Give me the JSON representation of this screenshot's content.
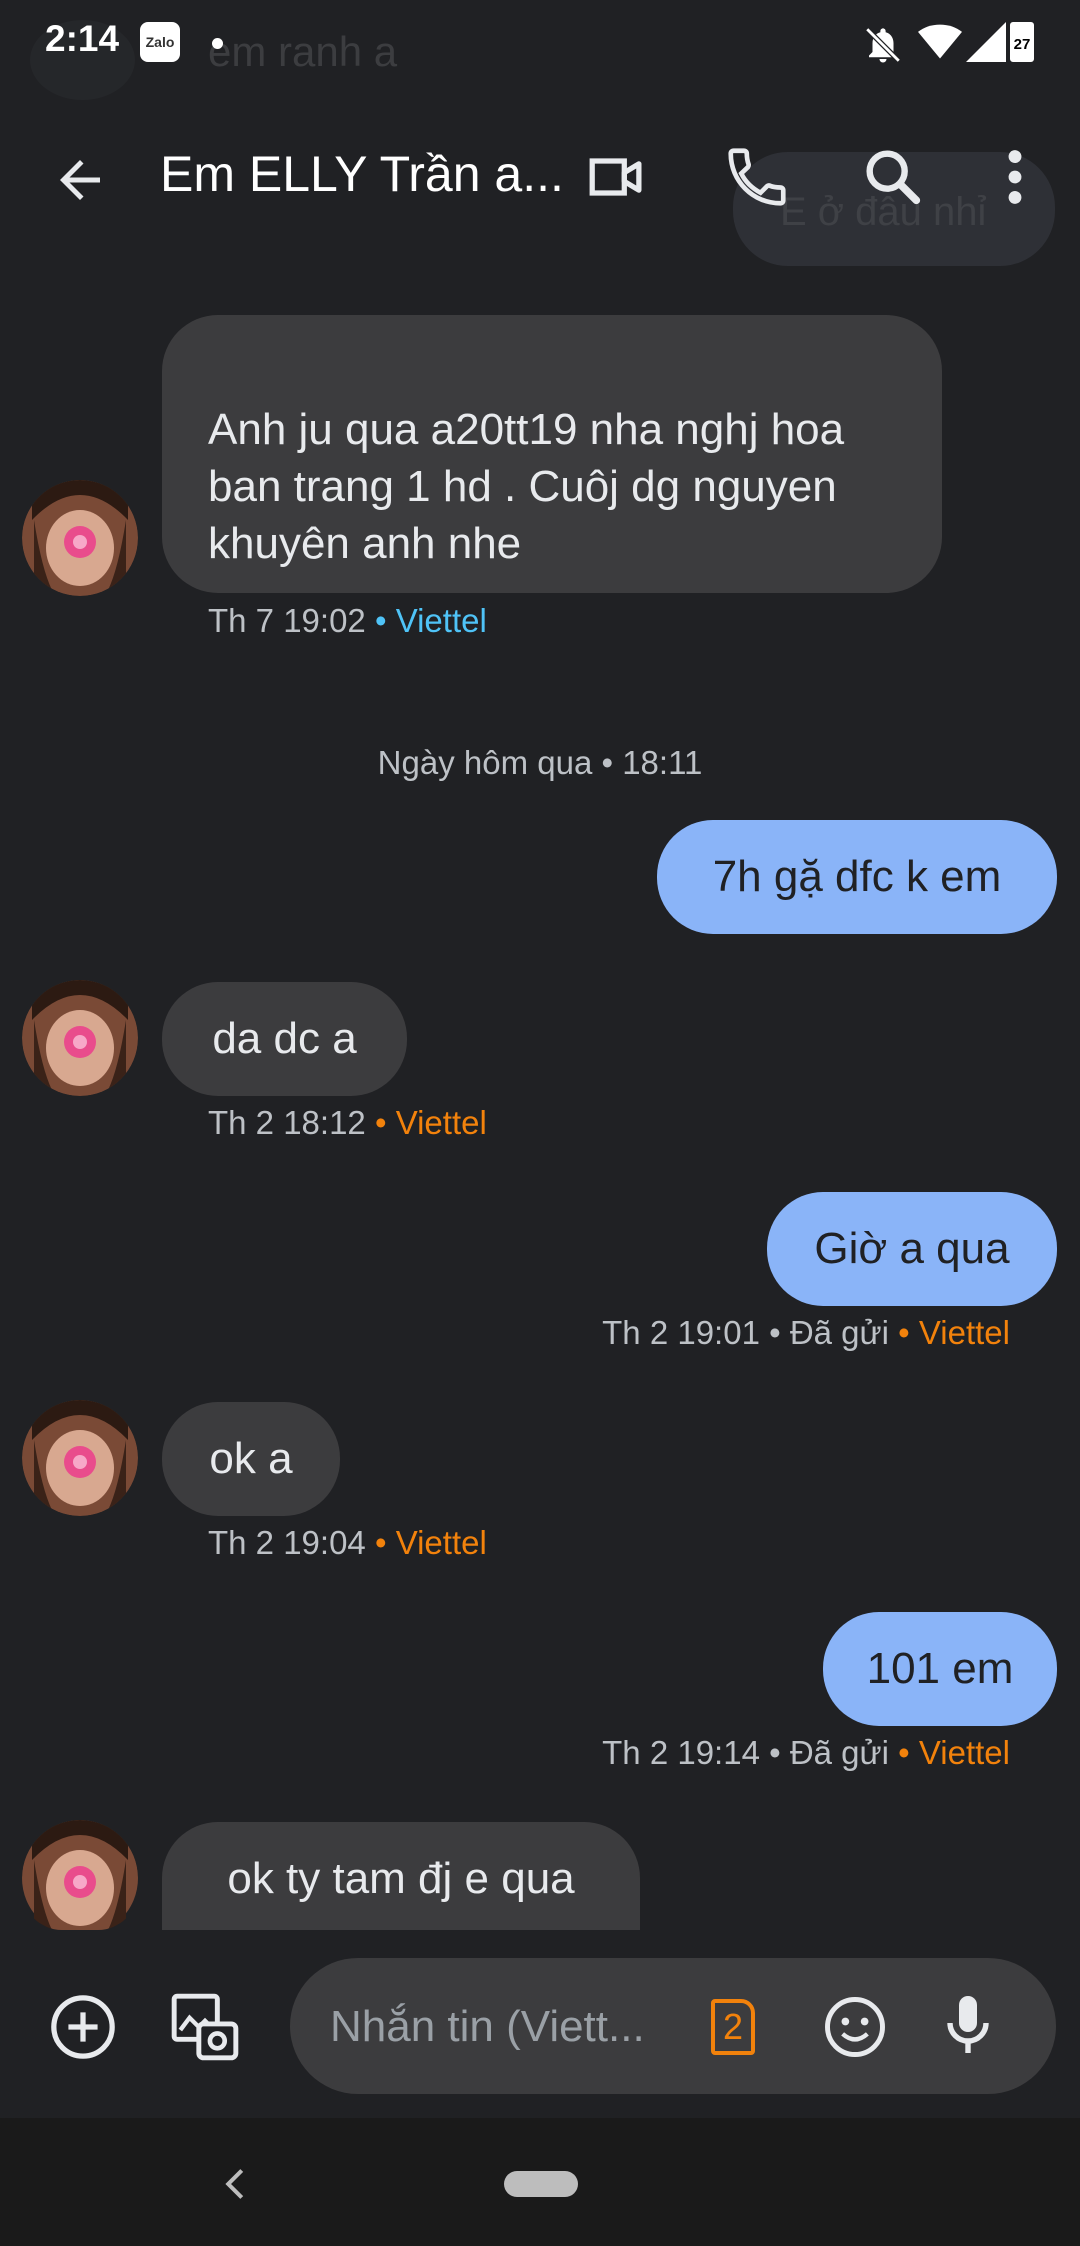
{
  "status_bar": {
    "time": "2:14",
    "zalo": "Zalo",
    "battery": "27"
  },
  "ghost": {
    "text1": "em ranh a",
    "text2": "E ở đâu nhỉ"
  },
  "header": {
    "title": "Em ELLY Trần a..."
  },
  "messages": [
    {
      "dir": "in",
      "text": "Anh ju qua a20tt19 nha nghj hoa ban trang 1  hd . Cuôj dg nguyen khuyên anh nhe",
      "time": "Th 7 19:02",
      "carrier": "Viettel",
      "carrier_color": "#4fc3f7"
    },
    {
      "dir": "out",
      "text": "7h gặ dfc k em"
    },
    {
      "dir": "in",
      "text": "da dc a",
      "time": "Th 2 18:12",
      "carrier": "Viettel",
      "carrier_color": "#f2820c"
    },
    {
      "dir": "out",
      "text": "Giờ a qua",
      "time": "Th 2 19:01",
      "status": "Đã gửi",
      "carrier": "Viettel"
    },
    {
      "dir": "in",
      "text": "ok a",
      "time": "Th 2 19:04",
      "carrier": "Viettel"
    },
    {
      "dir": "out",
      "text": "101 em",
      "time": "Th 2 19:14",
      "status": "Đã gửi",
      "carrier": "Viettel"
    },
    {
      "dir": "in",
      "text": "ok ty tam đj e qua"
    }
  ],
  "date_separator": "Ngày hôm qua • 18:11",
  "bullet": "•",
  "composer": {
    "placeholder": "Nhắn tin (Viett...",
    "sim_number": "2"
  },
  "colors": {
    "background": "#202124",
    "incoming_bubble": "#3c3c3e",
    "outgoing_bubble": "#8ab4f8",
    "carrier_blue": "#4fc3f7",
    "carrier_orange": "#f2820c"
  }
}
